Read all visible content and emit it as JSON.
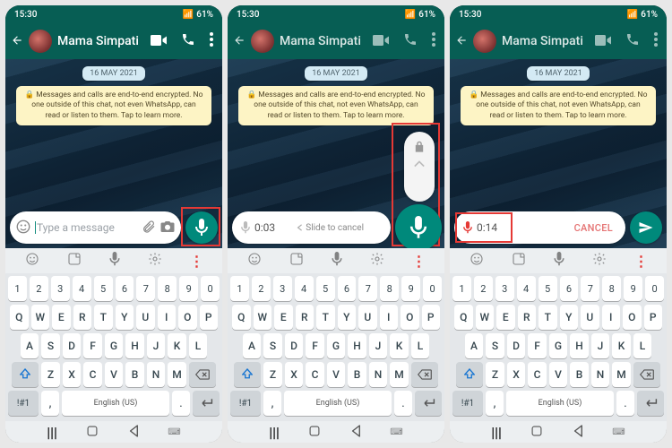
{
  "status": {
    "time": "15:30",
    "battery": "61%"
  },
  "header": {
    "name": "Mama Simpati"
  },
  "chat": {
    "date": "16 MAY 2021",
    "encryption": "🔒 Messages and calls are end-to-end encrypted. No one outside of this chat, not even WhatsApp, can read or listen to them. Tap to learn more."
  },
  "input": {
    "placeholder": "Type a message",
    "rec_time_1": "0:03",
    "slide_hint": "Slide to cancel",
    "rec_time_2": "0:14",
    "cancel": "CANCEL"
  },
  "keyboard": {
    "nums": [
      "1",
      "2",
      "3",
      "4",
      "5",
      "6",
      "7",
      "8",
      "9",
      "0"
    ],
    "top": [
      "Q",
      "W",
      "E",
      "R",
      "T",
      "Y",
      "U",
      "I",
      "O",
      "P"
    ],
    "mid": [
      "A",
      "S",
      "D",
      "F",
      "G",
      "H",
      "J",
      "K",
      "L"
    ],
    "bot": [
      "Z",
      "X",
      "C",
      "V",
      "B",
      "N",
      "M"
    ],
    "sym": "!#1",
    "lang": "English (US)",
    "comma": ",",
    "dot": "."
  }
}
